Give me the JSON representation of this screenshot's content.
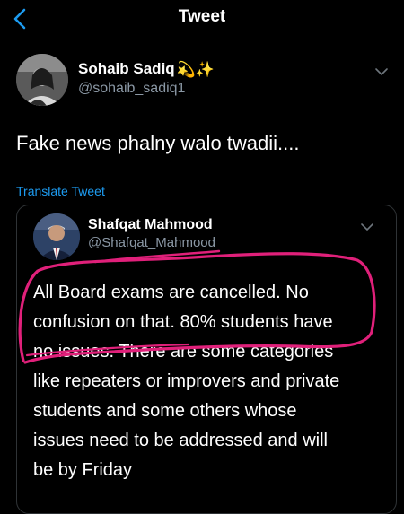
{
  "header": {
    "title": "Tweet",
    "back_icon": "chevron-left-icon"
  },
  "tweet": {
    "author_name": "Sohaib Sadiq",
    "author_emoji": "💫✨",
    "author_handle": "@sohaib_sadiq1",
    "text": "Fake news phalny walo twadii....",
    "translate_label": "Translate Tweet"
  },
  "quoted_tweet": {
    "author_name": "Shafqat Mahmood",
    "author_handle": "@Shafqat_Mahmood",
    "lines": [
      "All Board exams are cancelled. No",
      "confusion on that. 80% students have",
      "no issues. There are some categories",
      "like repeaters or improvers and private",
      "students and some others whose",
      "issues need to be addressed and will",
      "be by Friday"
    ]
  },
  "colors": {
    "background": "#000000",
    "text": "#ffffff",
    "secondary_text": "#8b98a5",
    "accent": "#1d9bf0",
    "annotation": "#e0207a"
  }
}
